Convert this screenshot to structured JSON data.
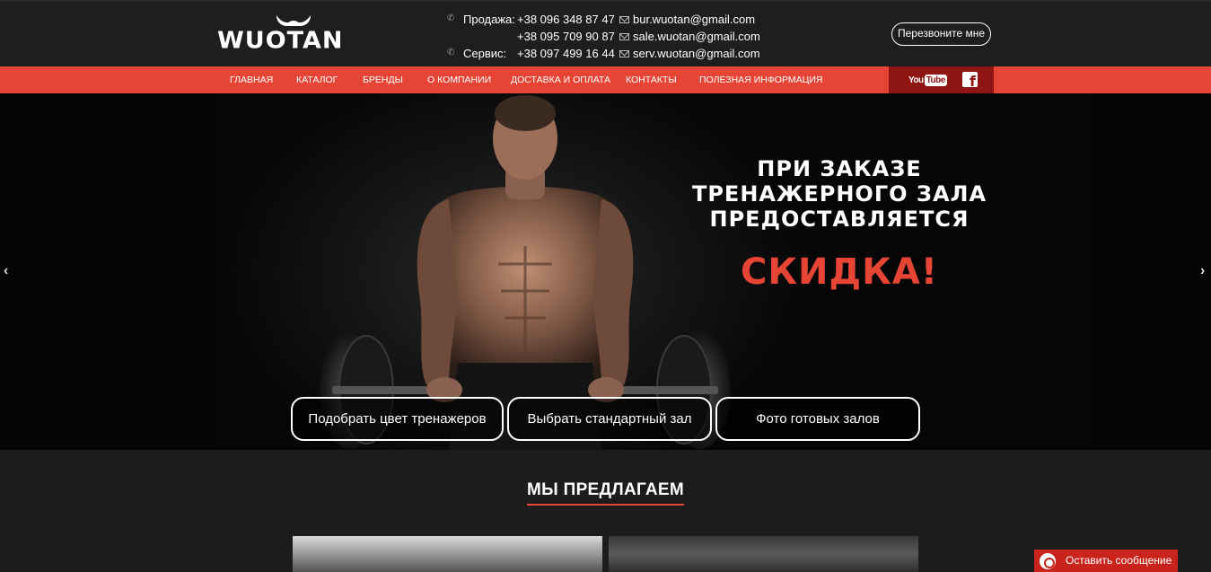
{
  "header": {
    "logo_text": "WUOTAN",
    "phones": [
      {
        "label": "Продажа:",
        "number": "+38 096 348 87 47"
      },
      {
        "label": "",
        "number": "+38 095 709 90 87"
      },
      {
        "label": "Сервис:",
        "number": "+38 097 499 16 44"
      }
    ],
    "emails": [
      "bur.wuotan@gmail.com",
      "sale.wuotan@gmail.com",
      "serv.wuotan@gmail.com"
    ],
    "callback_label": "Перезвоните мне"
  },
  "nav": {
    "items": [
      "Главная",
      "Каталог",
      "Бренды",
      "О компании",
      "Доставка и оплата",
      "Контакты",
      "Полезная информация"
    ],
    "youtube_label": "You",
    "youtube_tube": "Tube",
    "facebook_label": "f"
  },
  "hero": {
    "slogan_lines": [
      "ПРИ ЗАКАЗЕ",
      "ТРЕНАЖЕРНОГО ЗАЛА",
      "ПРЕДОСТАВЛЯЕТСЯ"
    ],
    "sale_text": "СКИДКА!",
    "prev_arrow": "‹",
    "next_arrow": "›",
    "buttons": [
      "Подобрать цвет тренажеров",
      "Выбрать стандартный зал",
      "Фото готовых залов"
    ]
  },
  "offer": {
    "title": "МЫ ПРЕДЛАГАЕМ"
  },
  "chat": {
    "label": "Оставить сообщение"
  },
  "colors": {
    "accent": "#e64536",
    "social_bg": "#8e1512",
    "header_bg": "#1e1e1e",
    "chat_bg": "#c8241c"
  },
  "icons": [
    "phone-icon",
    "envelope-icon",
    "youtube-icon",
    "facebook-icon",
    "chat-bubble-icon",
    "chevron-left-icon",
    "chevron-right-icon"
  ]
}
